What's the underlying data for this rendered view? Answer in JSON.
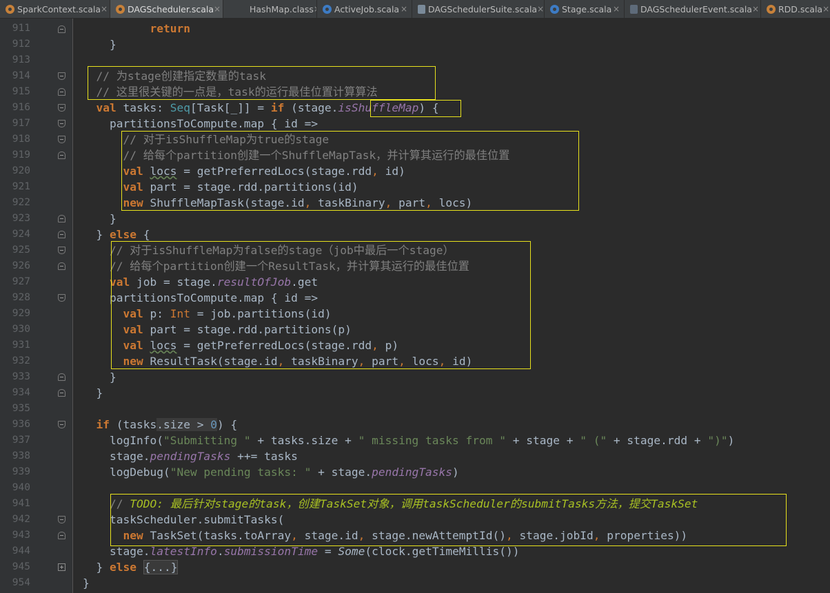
{
  "tabs": [
    {
      "label": "SparkContext.scala",
      "active": false,
      "icon": "scala-object-icon"
    },
    {
      "label": "DAGScheduler.scala",
      "active": true,
      "icon": "scala-object-icon"
    },
    {
      "label": "HashMap.class",
      "active": false,
      "icon": "class-file-icon"
    },
    {
      "label": "ActiveJob.scala",
      "active": false,
      "icon": "scala-class-icon"
    },
    {
      "label": "DAGSchedulerSuite.scala",
      "active": false,
      "icon": "scala-class-icon"
    },
    {
      "label": "Stage.scala",
      "active": false,
      "icon": "scala-class-icon"
    },
    {
      "label": "DAGSchedulerEvent.scala",
      "active": false,
      "icon": "scala-trait-icon"
    },
    {
      "label": "RDD.scala",
      "active": false,
      "icon": "scala-class-icon"
    }
  ],
  "close_glyph": "×",
  "line_numbers": [
    "911",
    "912",
    "913",
    "914",
    "915",
    "916",
    "917",
    "918",
    "919",
    "920",
    "921",
    "922",
    "923",
    "924",
    "925",
    "926",
    "927",
    "928",
    "929",
    "930",
    "931",
    "932",
    "933",
    "934",
    "935",
    "936",
    "937",
    "938",
    "939",
    "940",
    "941",
    "942",
    "943",
    "944",
    "945",
    "954"
  ],
  "code": {
    "l911_kw": "return",
    "l912": "}",
    "l914": "// 为stage创建指定数量的task",
    "l915": "// 这里很关键的一点是，task的运行最佳位置计算算法",
    "l916": {
      "val": "val",
      "name": " tasks: ",
      "seq": "Seq",
      "type": "[Task[_]] = ",
      "if": "if",
      "open": " (stage.",
      "field": "isShuffleMap",
      "close": ") {"
    },
    "l917": "partitionsToCompute.map { id =>",
    "l918": "// 对于isShuffleMap为true的stage",
    "l919": "// 给每个partition创建一个ShuffleMapTask，并计算其运行的最佳位置",
    "l920": {
      "kw": "val",
      "sp": " ",
      "v": "locs",
      "rest1": " = getPreferredLocs(stage.rdd",
      "comma": ",",
      "rest2": " id)"
    },
    "l921": {
      "kw": "val",
      "rest": " part = stage.rdd.partitions(id)"
    },
    "l922": {
      "kw": "new",
      "a": " ShuffleMapTask(stage.id",
      "b": " taskBinary",
      "c": " part",
      "d": " locs)"
    },
    "l923": "}",
    "l924": {
      "a": "} ",
      "kw": "else",
      "b": " {"
    },
    "l925": "// 对于isShuffleMap为false的stage（job中最后一个stage）",
    "l926": "// 给每个partition创建一个ResultTask，并计算其运行的最佳位置",
    "l927": {
      "kw": "val",
      "a": " job = stage.",
      "field": "resultOfJob",
      "b": ".get"
    },
    "l928": "partitionsToCompute.map { id =>",
    "l929": {
      "kw": "val",
      "a": " p: ",
      "type": "Int",
      "b": " = job.partitions(id)"
    },
    "l930": {
      "kw": "val",
      "rest": " part = stage.rdd.partitions(p)"
    },
    "l931": {
      "kw": "val",
      "sp": " ",
      "v": "locs",
      "rest1": " = getPreferredLocs(stage.rdd",
      "rest2": " p)"
    },
    "l932": {
      "kw": "new",
      "a": " ResultTask(stage.id",
      "b": " taskBinary",
      "c": " part",
      "d": " locs",
      "e": " id)"
    },
    "l933": "}",
    "l934": "}",
    "l936": {
      "kw": "if",
      "a": " (tasks",
      "b": ".size > ",
      "num": "0",
      "c": ") {"
    },
    "l937": {
      "a": "logInfo(",
      "s1": "\"Submitting \"",
      "b": " + tasks.size + ",
      "s2": "\" missing tasks from \"",
      "c": " + stage + ",
      "s3": "\" (\"",
      "d": " + stage.rdd + ",
      "s4": "\")\"",
      "e": ")"
    },
    "l938": {
      "a": "stage.",
      "field": "pendingTasks",
      "b": " ++= tasks"
    },
    "l939": {
      "a": "logDebug(",
      "s": "\"New pending tasks: \"",
      "b": " + stage.",
      "field": "pendingTasks",
      "c": ")"
    },
    "l941": {
      "slash": "// ",
      "todo": "TODO: 最后针对stage的task，创建TaskSet对象，调用taskScheduler的submitTasks方法，提交TaskSet"
    },
    "l942": "taskScheduler.submitTasks(",
    "l943": {
      "kw": "new",
      "a": " TaskSet(tasks.toArray",
      "b": " stage.id",
      "c": " stage.newAttemptId()",
      "d": " stage.jobId",
      "e": " properties))"
    },
    "l944": {
      "a": "stage.",
      "f1": "latestInfo",
      "b": ".",
      "f2": "submissionTime",
      "c": " = ",
      "some": "Some",
      "d": "(clock.getTimeMillis())"
    },
    "l945": {
      "a": "} ",
      "kw": "else",
      "sp": " ",
      "fold": "{...}"
    },
    "l954": "}"
  },
  "colors": {
    "highlight_box": "#e8e21d",
    "background": "#2b2b2b",
    "keyword": "#cc7832",
    "comment": "#808080",
    "string": "#6a8759",
    "field": "#9876aa",
    "todo": "#a8c023"
  }
}
